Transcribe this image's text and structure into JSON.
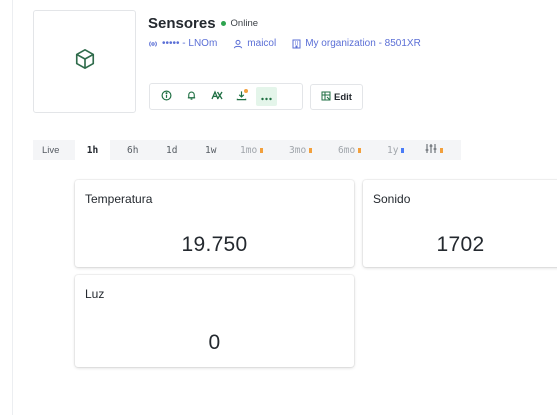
{
  "device": {
    "title": "Sensores",
    "status": "Online",
    "status_color": "#2ea44f",
    "identifier": "••••• - LNOm",
    "owner": "maicol",
    "organization": "My organization - 8501XR",
    "thumbnail_icon": "cube-icon"
  },
  "toolbar": {
    "icons": [
      "info-icon",
      "bell-icon",
      "api-icon",
      "download-icon",
      "more-icon"
    ],
    "edit_label": "Edit"
  },
  "timebar": {
    "live_label": "Live",
    "ranges": [
      "1h",
      "6h",
      "1d",
      "1w",
      "1mo",
      "3mo",
      "6mo",
      "1y"
    ],
    "selected": "1h",
    "accent_orange": "#f2a03d",
    "accent_blue": "#4a7cf7"
  },
  "widgets": [
    {
      "title": "Temperatura",
      "value": "19.750"
    },
    {
      "title": "Sonido",
      "value": "1702"
    },
    {
      "title": "Luz",
      "value": "0"
    }
  ]
}
